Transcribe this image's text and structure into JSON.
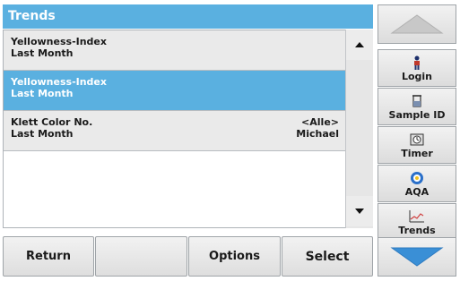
{
  "header": {
    "title": "Trends"
  },
  "list": {
    "items": [
      {
        "line1": "Yellowness-Index",
        "line2": "Last Month",
        "right1": "",
        "right2": "",
        "selected": false
      },
      {
        "line1": "Yellowness-Index",
        "line2": "Last Month",
        "right1": "",
        "right2": "",
        "selected": true
      },
      {
        "line1": "Klett Color No.",
        "line2": "Last Month",
        "right1": "<Alle>",
        "right2": "Michael",
        "selected": false
      }
    ]
  },
  "bottom_bar": {
    "return_label": "Return",
    "options_label": "Options",
    "select_label": "Select"
  },
  "side_bar": {
    "login_label": "Login",
    "sample_id_label": "Sample ID",
    "timer_label": "Timer",
    "aqa_label": "AQA",
    "trends_label": "Trends"
  },
  "icons": {
    "scroll_up": "triangle-up-icon",
    "scroll_down": "triangle-down-icon",
    "nav_up": "large-up-arrow-icon",
    "nav_down": "large-down-arrow-icon",
    "login": "person-icon",
    "sample_id": "sample-vial-icon",
    "timer": "timer-icon",
    "aqa": "aqa-icon",
    "trends": "trend-chart-icon"
  },
  "colors": {
    "accent": "#5ab0e0",
    "selected_row": "#5ab0e0",
    "nav_arrow_up": "#c8c8c8",
    "nav_arrow_down": "#3a8fd6"
  }
}
